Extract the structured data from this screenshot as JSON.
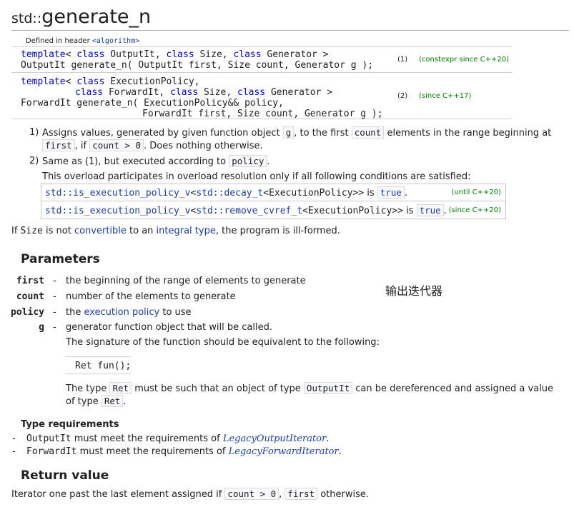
{
  "title": {
    "prefix": "std::",
    "name": "generate_n"
  },
  "header_line": {
    "label": "Defined in header ",
    "header": "<algorithm>"
  },
  "decls": [
    {
      "line1": [
        "template",
        "< ",
        "class",
        " OutputIt, ",
        "class",
        " Size, ",
        "class",
        " Generator >"
      ],
      "line2": "OutputIt generate_n( OutputIt first, Size count, Generator g );",
      "num": "(1)",
      "since": "(constexpr since C++20)"
    },
    {
      "line1": [
        "template",
        "< ",
        "class",
        " ExecutionPolicy,"
      ],
      "line2": [
        "class",
        " ForwardIt, ",
        "class",
        " Size, ",
        "class",
        " Generator >"
      ],
      "line3": "ForwardIt generate_n( ExecutionPolicy&& policy,",
      "line4": "ForwardIt first, Size count, Generator g );",
      "num": "(2)",
      "since": "(since C++17)"
    }
  ],
  "desc1": {
    "num": "1)",
    "t1": "Assigns values, generated by given function object ",
    "c1": "g",
    "t2": ", to the first ",
    "c2": "count",
    "t3": " elements in the range beginning at",
    "c3": "first",
    "t4": ", if ",
    "c4": "count > 0",
    "t5": ". Does nothing otherwise."
  },
  "desc2": {
    "num": "2)",
    "t1": "Same as (1), but executed according to ",
    "c1": "policy",
    "t2": ".",
    "overload": "This overload participates in overload resolution only if all following conditions are satisfied:"
  },
  "conditions": [
    {
      "a": "std::is_execution_policy_v",
      "b": "<",
      "c": "std::decay_t",
      "d": "<ExecutionPolicy>>",
      "is": " is ",
      "val": "true",
      "end": ".",
      "note": "(until C++20)"
    },
    {
      "a": "std::is_execution_policy_v",
      "b": "<",
      "c": "std::remove_cvref_t",
      "d": "<ExecutionPolicy>>",
      "is": " is ",
      "val": "true",
      "end": ".",
      "note": "(since C++20)"
    }
  ],
  "illformed": {
    "t1": "If ",
    "c1": "Size",
    "t2": " is not ",
    "l1": "convertible",
    "t3": " to an ",
    "l2": "integral type",
    "t4": ", the program is ill-formed."
  },
  "parameters": {
    "heading": "Parameters",
    "items": [
      {
        "name": "first",
        "dash": "-",
        "desc": "the beginning of the range of elements to generate"
      },
      {
        "name": "count",
        "dash": "-",
        "desc": "number of the elements to generate"
      },
      {
        "name": "policy",
        "dash": "-",
        "desc_pre": "the ",
        "desc_link": "execution policy",
        "desc_post": " to use"
      },
      {
        "name": "g",
        "dash": "-",
        "desc": "generator function object that will be called."
      }
    ],
    "sig_text": "The signature of the function should be equivalent to the following:",
    "sig_code": "Ret fun();",
    "ret_t1": "The type ",
    "ret_c1": "Ret",
    "ret_t2": " must be such that an object of type ",
    "ret_c2": "OutputIt",
    "ret_t3": " can be dereferenced and assigned a value",
    "ret_t4": "of type ",
    "ret_c3": "Ret",
    "ret_t5": ".",
    "annotation": "输出迭代器"
  },
  "type_req": {
    "heading": "Type requirements",
    "items": [
      {
        "dash": "-",
        "type": "OutputIt",
        "text": " must meet the requirements of ",
        "link": "LegacyOutputIterator",
        "end": "."
      },
      {
        "dash": "-",
        "type": "ForwardIt",
        "text": " must meet the requirements of ",
        "link": "LegacyForwardIterator",
        "end": "."
      }
    ]
  },
  "return_value": {
    "heading": "Return value",
    "t1": "Iterator one past the last element assigned if ",
    "c1": "count > 0",
    "t2": ", ",
    "c2": "first",
    "t3": " otherwise."
  }
}
